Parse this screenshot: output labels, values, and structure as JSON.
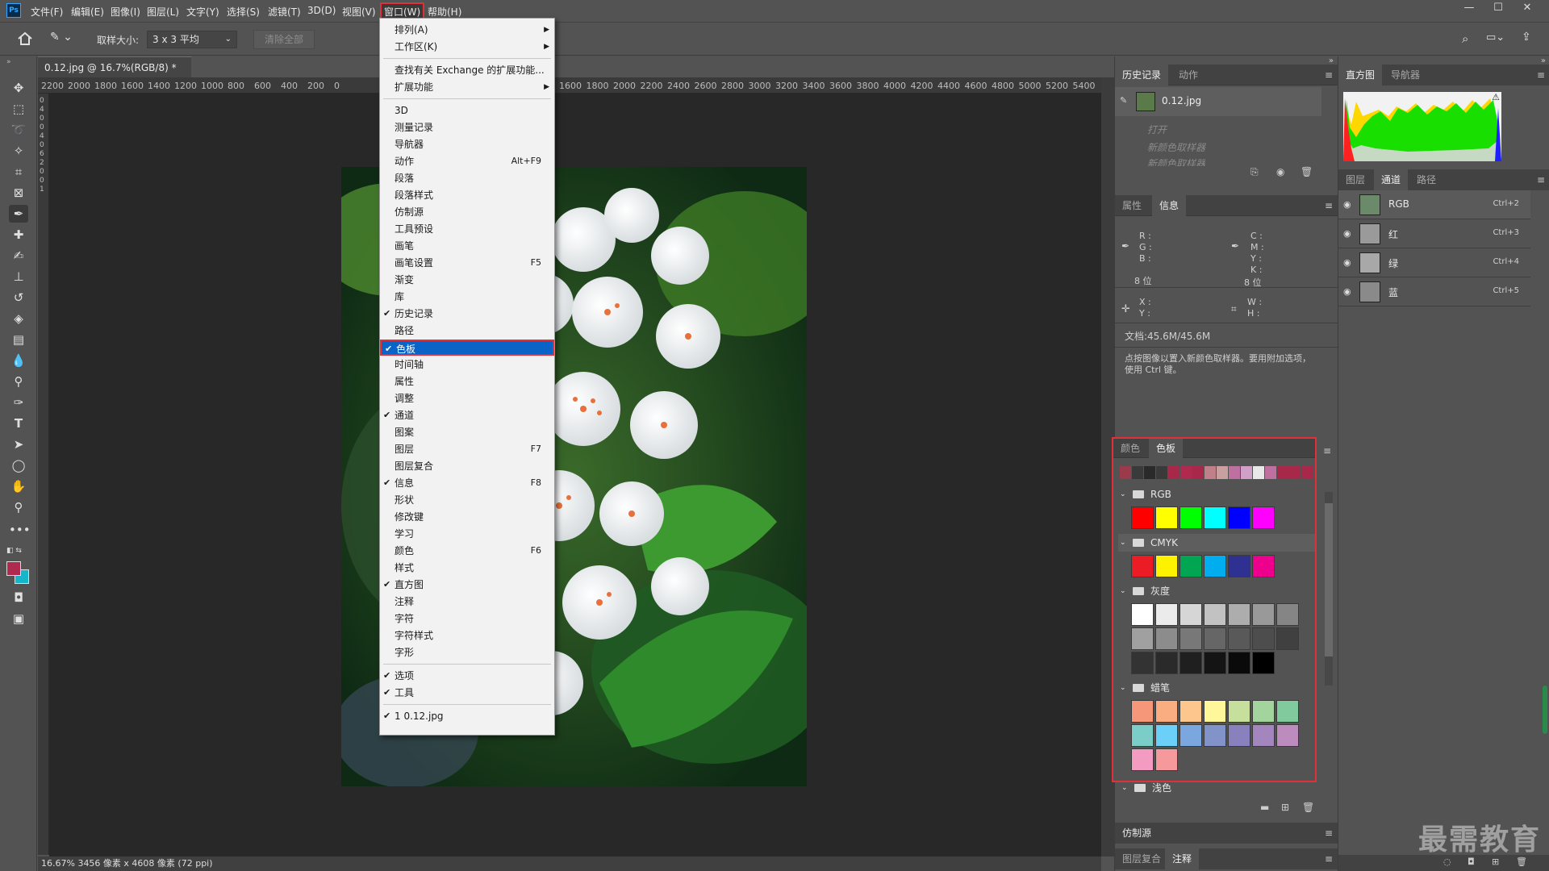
{
  "app": {
    "logo": "Ps"
  },
  "menubar": {
    "items": [
      "文件(F)",
      "编辑(E)",
      "图像(I)",
      "图层(L)",
      "文字(Y)",
      "选择(S)",
      "滤镜(T)",
      "3D(D)",
      "视图(V)",
      "窗口(W)",
      "帮助(H)"
    ],
    "active_index": 9
  },
  "window_controls": {
    "minimize": "—",
    "maximize": "☐",
    "close": "✕"
  },
  "options_bar": {
    "sample_size_label": "取样大小:",
    "sample_size_value": "3 x 3 平均",
    "clear_all_label": "清除全部"
  },
  "document": {
    "tab_title": "0.12.jpg @ 16.7%(RGB/8) *",
    "tab_close": "×",
    "status_text": "16.67%  3456 像素 x 4608 像素 (72 ppi)"
  },
  "ruler": {
    "left_labels": [
      "2200",
      "2000",
      "1800",
      "1600",
      "1400",
      "1200",
      "1000",
      "800",
      "600",
      "400",
      "200",
      "0"
    ],
    "right_labels": [
      "1600",
      "1800",
      "2000",
      "2200",
      "2400",
      "2600",
      "2800",
      "3000",
      "3200",
      "3400",
      "3600",
      "3800",
      "4000",
      "4200",
      "4400",
      "4600",
      "4800",
      "5000",
      "5200",
      "5400"
    ],
    "left_value": "0"
  },
  "window_menu": {
    "items": [
      {
        "label": "排列(A)",
        "submenu": true
      },
      {
        "label": "工作区(K)",
        "submenu": true
      },
      {
        "sep": true
      },
      {
        "label": "查找有关 Exchange 的扩展功能..."
      },
      {
        "label": "扩展功能",
        "submenu": true
      },
      {
        "sep": true
      },
      {
        "label": "3D"
      },
      {
        "label": "测量记录"
      },
      {
        "label": "导航器"
      },
      {
        "label": "动作",
        "shortcut": "Alt+F9"
      },
      {
        "label": "段落"
      },
      {
        "label": "段落样式"
      },
      {
        "label": "仿制源"
      },
      {
        "label": "工具预设"
      },
      {
        "label": "画笔"
      },
      {
        "label": "画笔设置",
        "shortcut": "F5"
      },
      {
        "label": "渐变"
      },
      {
        "label": "库"
      },
      {
        "label": "历史记录",
        "checked": true
      },
      {
        "label": "路径"
      },
      {
        "label": "色板",
        "checked": true,
        "highlighted": true
      },
      {
        "label": "时间轴"
      },
      {
        "label": "属性"
      },
      {
        "label": "调整"
      },
      {
        "label": "通道",
        "checked": true
      },
      {
        "label": "图案"
      },
      {
        "label": "图层",
        "shortcut": "F7"
      },
      {
        "label": "图层复合"
      },
      {
        "label": "信息",
        "checked": true,
        "shortcut": "F8"
      },
      {
        "label": "形状"
      },
      {
        "label": "修改键"
      },
      {
        "label": "学习"
      },
      {
        "label": "颜色",
        "shortcut": "F6"
      },
      {
        "label": "样式"
      },
      {
        "label": "直方图",
        "checked": true
      },
      {
        "label": "注释"
      },
      {
        "label": "字符"
      },
      {
        "label": "字符样式"
      },
      {
        "label": "字形"
      },
      {
        "sep": true
      },
      {
        "label": "选项",
        "checked": true
      },
      {
        "label": "工具",
        "checked": true
      },
      {
        "sep": true
      },
      {
        "label": "1 0.12.jpg",
        "checked": true
      }
    ]
  },
  "history_panel": {
    "tabs": [
      "历史记录",
      "动作"
    ],
    "snapshot": "0.12.jpg",
    "steps": [
      "打开",
      "新颜色取样器",
      "新颜色取样器"
    ]
  },
  "info_panel": {
    "tabs": [
      "属性",
      "信息"
    ],
    "rgb_labels": [
      "R :",
      "G :",
      "B :"
    ],
    "cmyk_labels": [
      "C :",
      "M :",
      "Y :",
      "K :"
    ],
    "bit_left": "8 位",
    "bit_right": "8 位",
    "xy_labels": [
      "X :",
      "Y :"
    ],
    "wh_labels": [
      "W :",
      "H :"
    ],
    "doc_size": "文档:45.6M/45.6M",
    "hint": "点按图像以置入新颜色取样器。要用附加选项，使用 Ctrl 键。"
  },
  "histogram_panel": {
    "tabs": [
      "直方图",
      "导航器"
    ],
    "warning": "⚠"
  },
  "channels_panel": {
    "tabs": [
      "图层",
      "通道",
      "路径"
    ],
    "channels": [
      {
        "name": "RGB",
        "shortcut": "Ctrl+2"
      },
      {
        "name": "红",
        "shortcut": "Ctrl+3"
      },
      {
        "name": "绿",
        "shortcut": "Ctrl+4"
      },
      {
        "name": "蓝",
        "shortcut": "Ctrl+5"
      }
    ]
  },
  "swatches_panel": {
    "tabs": [
      "颜色",
      "色板"
    ],
    "recent": [
      "#9a3a4a",
      "#3a3a3a",
      "#2a2a2a",
      "#3a3a3a",
      "#a8284a",
      "#b02a50",
      "#a8284a",
      "#c0808a",
      "#c8a0a0",
      "#c070a0",
      "#d0a0c8",
      "#e8e8e8",
      "#c070a0",
      "#a8284a",
      "#a8284a",
      "#a8284a"
    ],
    "groups": [
      {
        "name": "RGB",
        "colors": [
          "#ff0000",
          "#ffff00",
          "#00ff00",
          "#00ffff",
          "#0000ff",
          "#ff00ff"
        ]
      },
      {
        "name": "CMYK",
        "colors": [
          "#ec1c24",
          "#fff200",
          "#00a651",
          "#00aeef",
          "#2e3192",
          "#ec008c"
        ]
      },
      {
        "name": "灰度",
        "colors": [
          "#ffffff",
          "#ebebeb",
          "#d6d6d6",
          "#c2c2c2",
          "#adadad",
          "#999999",
          "#858585",
          "#a0a0a0",
          "#8c8c8c",
          "#787878",
          "#666666",
          "#595959",
          "#4d4d4d",
          "#404040",
          "#333333",
          "#2a2a2a",
          "#1f1f1f",
          "#141414",
          "#0a0a0a",
          "#000000"
        ]
      },
      {
        "name": "蜡笔",
        "colors": [
          "#f7977a",
          "#fbad82",
          "#fdc68c",
          "#fff799",
          "#c6df9c",
          "#a4d49d",
          "#81ca9d",
          "#7bcdc8",
          "#6ccff7",
          "#7ba7e1",
          "#8293ca",
          "#8881be",
          "#a286bd",
          "#bc8cbf",
          "#f49bc1",
          "#f5999d"
        ]
      }
    ],
    "next_group": "浅色"
  },
  "clone_panel": {
    "tabs": [
      "仿制源"
    ]
  },
  "layer_comps_panel": {
    "tabs": [
      "图层复合",
      "注释"
    ]
  },
  "watermark": "最需教育"
}
